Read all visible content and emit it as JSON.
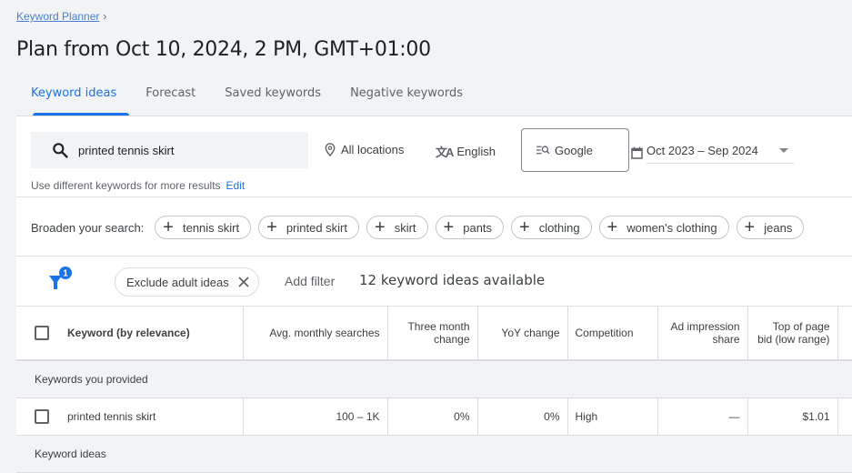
{
  "breadcrumb": {
    "parent": "Keyword Planner",
    "chevron": "›"
  },
  "page_title": "Plan from Oct 10, 2024, 2 PM, GMT+01:00",
  "tabs": [
    {
      "label": "Keyword ideas",
      "active": true
    },
    {
      "label": "Forecast",
      "active": false
    },
    {
      "label": "Saved keywords",
      "active": false
    },
    {
      "label": "Negative keywords",
      "active": false
    }
  ],
  "search": {
    "value": "printed tennis skirt",
    "icon": "search-icon"
  },
  "targeting": {
    "location": "All locations",
    "language": "English",
    "network": "Google",
    "date_range": "Oct 2023 – Sep 2024"
  },
  "hint": {
    "text": "Use different keywords for more results",
    "edit_label": "Edit"
  },
  "broaden": {
    "label": "Broaden your search:",
    "chips": [
      "tennis skirt",
      "printed skirt",
      "skirt",
      "pants",
      "clothing",
      "women's clothing",
      "jeans"
    ]
  },
  "filters": {
    "badge_count": "1",
    "active_filter": "Exclude adult ideas",
    "add_filter_label": "Add filter",
    "results_count": "12 keyword ideas available"
  },
  "table": {
    "columns": {
      "keyword": "Keyword (by relevance)",
      "avg_monthly": "Avg. monthly searches",
      "three_month_1": "Three month",
      "three_month_2": "change",
      "yoy": "YoY change",
      "competition": "Competition",
      "ad_impr_1": "Ad impression",
      "ad_impr_2": "share",
      "bid_low_1": "Top of page",
      "bid_low_2": "bid (low range)"
    },
    "groups": [
      {
        "title": "Keywords you provided",
        "rows": [
          {
            "keyword": "printed tennis skirt",
            "avg_monthly": "100 – 1K",
            "three_month": "0%",
            "yoy": "0%",
            "competition": "High",
            "ad_impression_share": "—",
            "bid_low": "$1.01"
          }
        ]
      },
      {
        "title": "Keyword ideas",
        "rows": []
      }
    ]
  },
  "colors": {
    "accent": "#1a73e8",
    "page_bg": "#f1f3f4",
    "text": "#3c4043"
  }
}
